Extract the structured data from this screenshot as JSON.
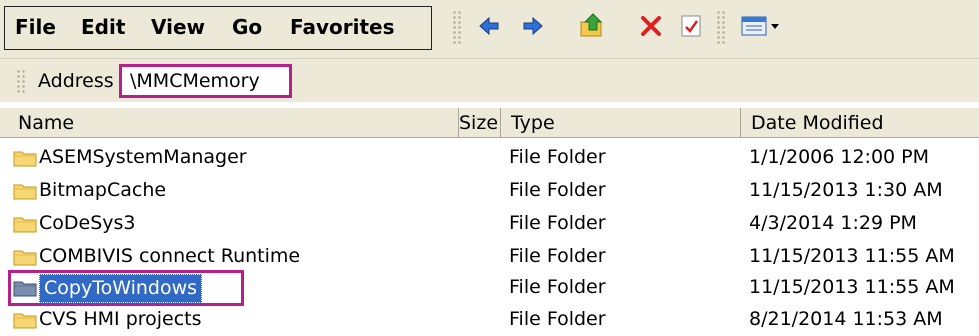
{
  "menu": {
    "file": "File",
    "edit": "Edit",
    "view": "View",
    "go": "Go",
    "favorites": "Favorites"
  },
  "toolbar": {
    "icons": [
      "back-arrow-icon",
      "forward-arrow-icon",
      "up-folder-icon",
      "delete-icon",
      "properties-icon",
      "views-icon"
    ]
  },
  "address": {
    "label": "Address",
    "value": "\\MMCMemory"
  },
  "columns": {
    "name": "Name",
    "size": "Size",
    "type": "Type",
    "date": "Date Modified"
  },
  "rows": [
    {
      "name": "ASEMSystemManager",
      "type": "File Folder",
      "date": "1/1/2006 12:00 PM"
    },
    {
      "name": "BitmapCache",
      "type": "File Folder",
      "date": "11/15/2013 1:30 AM"
    },
    {
      "name": "CoDeSys3",
      "type": "File Folder",
      "date": "4/3/2014 1:29 PM"
    },
    {
      "name": "COMBIVIS connect Runtime",
      "type": "File Folder",
      "date": "11/15/2013 11:55 AM"
    },
    {
      "name": "CopyToWindows",
      "type": "File Folder",
      "date": "11/15/2013 11:55 AM"
    },
    {
      "name": "CVS HMI projects",
      "type": "File Folder",
      "date": "8/21/2014 11:53 AM"
    }
  ],
  "colors": {
    "highlight": "#b5208a",
    "selection": "#316ac5",
    "chrome": "#ece9d8"
  }
}
